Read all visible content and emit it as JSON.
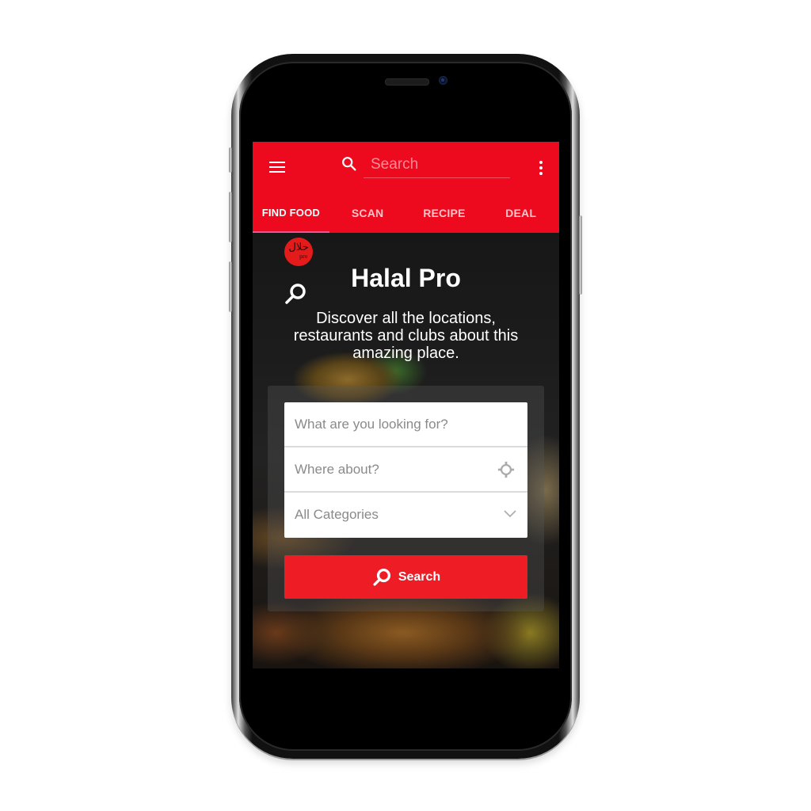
{
  "app": {
    "name": "Halal Pro",
    "logo_text": "حلال",
    "logo_sub": "pro"
  },
  "appbar": {
    "menu_icon": "hamburger-menu-icon",
    "search_icon": "search-icon",
    "search_placeholder": "Search",
    "more_icon": "more-vert-icon"
  },
  "tabs": [
    {
      "label": "FIND FOOD",
      "active": true
    },
    {
      "label": "SCAN",
      "active": false
    },
    {
      "label": "RECIPE",
      "active": false
    },
    {
      "label": "DEAL",
      "active": false
    }
  ],
  "hero": {
    "title": "Halal Pro",
    "subtitle": "Discover all the locations, restaurants and clubs about this amazing place."
  },
  "form": {
    "what_placeholder": "What are you looking for?",
    "where_placeholder": "Where about?",
    "category_selected": "All Categories",
    "search_button_label": "Search"
  },
  "colors": {
    "brand_red": "#ee0a1e",
    "button_red": "#ee1c25",
    "tab_indicator": "#ff4f8a"
  }
}
